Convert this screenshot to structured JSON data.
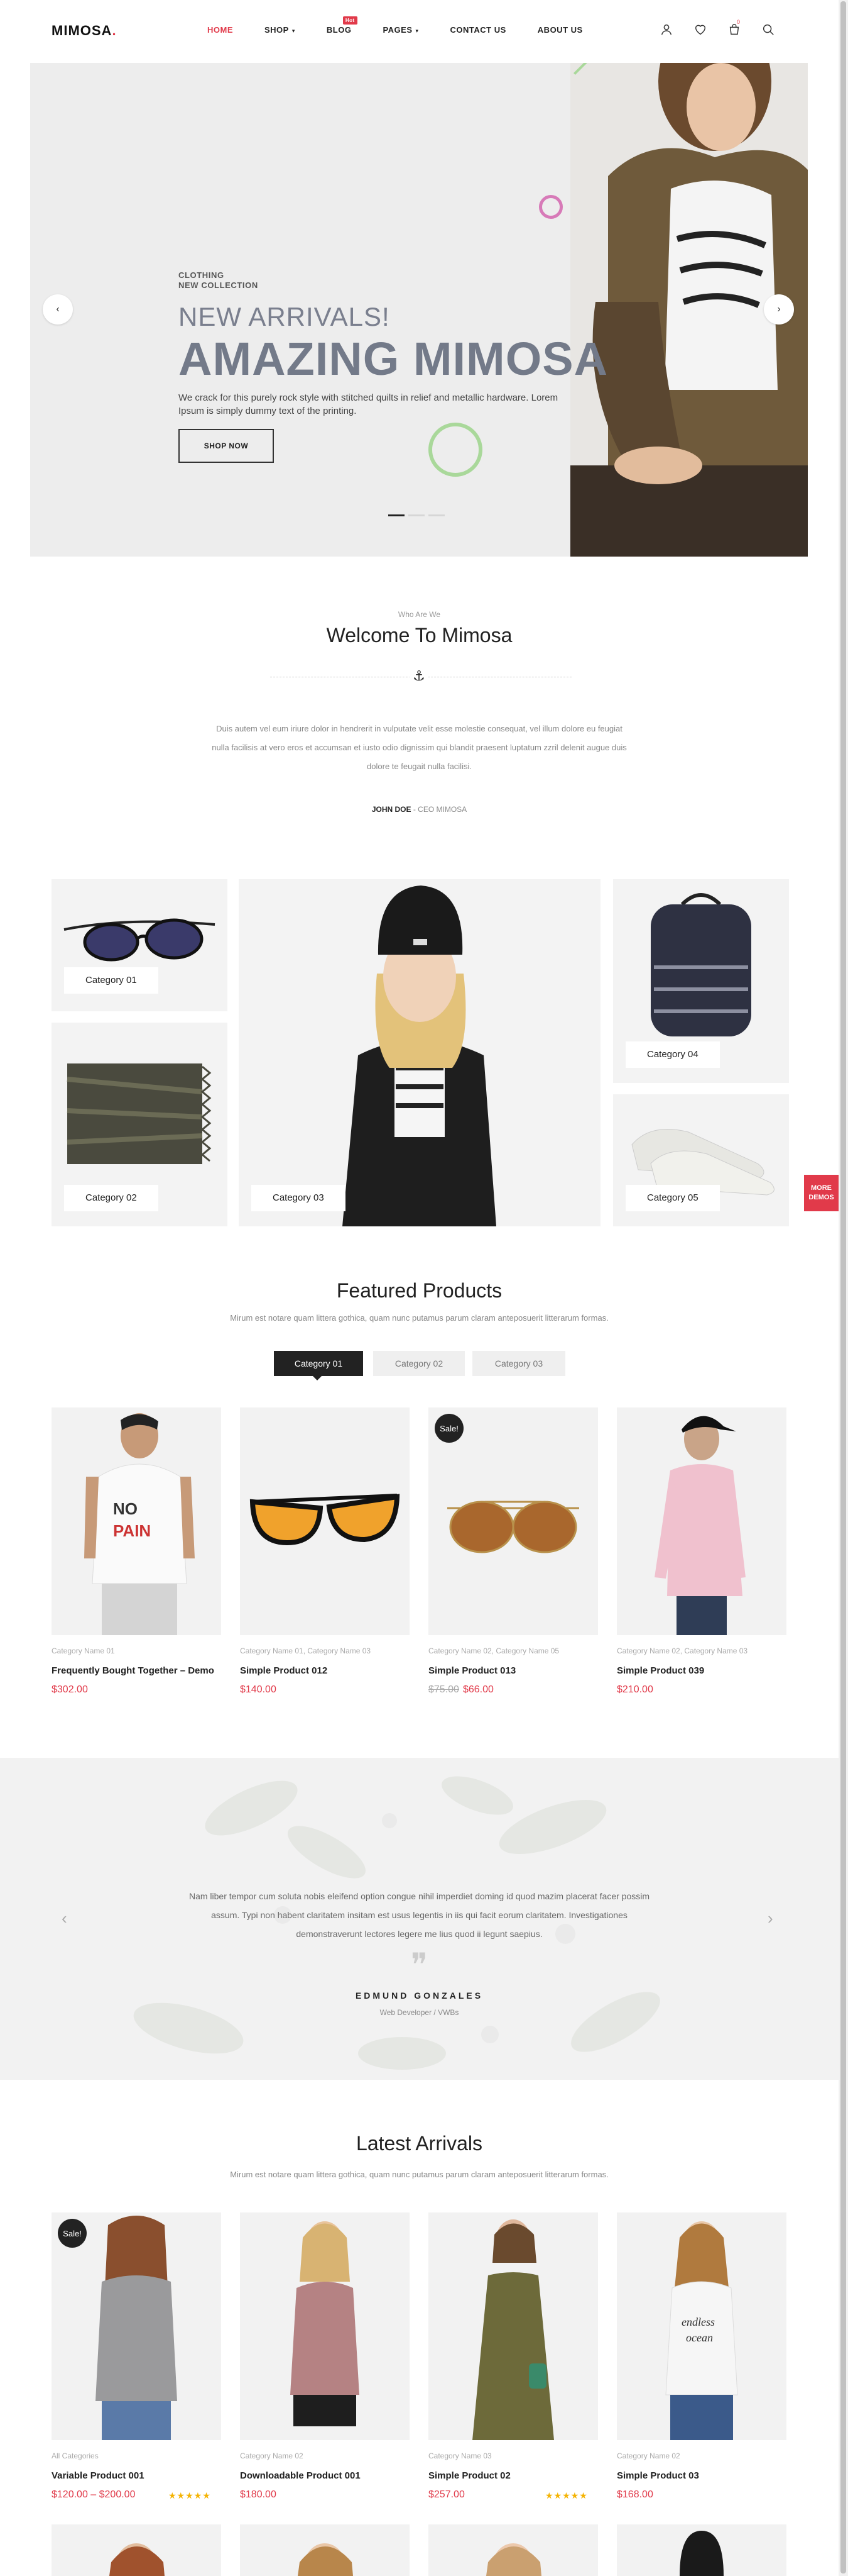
{
  "header": {
    "logo": "MIMOSA",
    "logo_dot": ".",
    "nav": [
      {
        "label": "HOME",
        "caret": ""
      },
      {
        "label": "SHOP",
        "caret": "▾"
      },
      {
        "label": "BLOG",
        "caret": "",
        "badge": "Hot"
      },
      {
        "label": "PAGES",
        "caret": "▾"
      },
      {
        "label": "CONTACT US",
        "caret": ""
      },
      {
        "label": "ABOUT US",
        "caret": ""
      }
    ],
    "cart_count": "0",
    "icons": [
      "user-icon",
      "heart-icon",
      "cart-icon",
      "search-icon"
    ]
  },
  "hero": {
    "subtitle_line1": "CLOTHING",
    "subtitle_line2": "NEW COLLECTION",
    "heading": "NEW ARRIVALS!",
    "title": "AMAZING MIMOSA",
    "description": "We crack for this purely rock style with stitched quilts in relief and metallic hardware. Lorem Ipsum is simply dummy text of the printing.",
    "button": "SHOP NOW",
    "prev": "‹",
    "next": "›"
  },
  "welcome": {
    "eyebrow": "Who Are We",
    "title": "Welcome To Mimosa",
    "text": "Duis autem vel eum iriure dolor in hendrerit in vulputate velit esse molestie consequat, vel illum dolore eu feugiat nulla facilisis at vero eros et accumsan et iusto odio dignissim qui blandit praesent luptatum zzril delenit augue duis dolore te feugait nulla facilisi.",
    "ceo_name": "JOHN DOE",
    "ceo_role": " - CEO MIMOSA"
  },
  "categories": [
    "Category 01",
    "Category 02",
    "Category 03",
    "Category 04",
    "Category 05"
  ],
  "more_demos": "MORE DEMOS",
  "featured": {
    "title": "Featured Products",
    "subtitle": "Mirum est notare quam littera gothica, quam nunc putamus parum claram anteposuerit litterarum formas.",
    "tabs": [
      "Category 01",
      "Category 02",
      "Category 03"
    ],
    "products": [
      {
        "cats": "Category Name 01",
        "name": "Frequently Bought Together – Demo",
        "price": "$302.00",
        "old_price": "",
        "sale": ""
      },
      {
        "cats": "Category Name 01, Category Name 03",
        "name": "Simple Product 012",
        "price": "$140.00",
        "old_price": "",
        "sale": ""
      },
      {
        "cats": "Category Name 02, Category Name 05",
        "name": "Simple Product 013",
        "price": "$66.00",
        "old_price": "$75.00",
        "sale": "Sale!"
      },
      {
        "cats": "Category Name 02, Category Name 03",
        "name": "Simple Product 039",
        "price": "$210.00",
        "old_price": "",
        "sale": ""
      }
    ]
  },
  "testimonial": {
    "text": "Nam liber tempor cum soluta nobis eleifend option congue nihil imperdiet doming id quod mazim placerat facer possim assum. Typi non habent claritatem insitam est usus legentis in iis qui facit eorum claritatem. Investigationes demonstraverunt lectores legere me lius quod ii legunt saepius.",
    "quote": "❞",
    "name": "EDMUND GONZALES",
    "role": "Web Developer / VWBs",
    "prev": "‹",
    "next": "›"
  },
  "latest": {
    "title": "Latest Arrivals",
    "subtitle": "Mirum est notare quam littera gothica, quam nunc putamus parum claram anteposuerit litterarum formas.",
    "products": [
      {
        "cats": "All Categories",
        "name": "Variable Product 001",
        "price": "$120.00 – $200.00",
        "sale": "Sale!",
        "stars": "★★★★★"
      },
      {
        "cats": "Category Name 02",
        "name": "Downloadable Product 001",
        "price": "$180.00",
        "sale": "",
        "stars": ""
      },
      {
        "cats": "Category Name 03",
        "name": "Simple Product 02",
        "price": "$257.00",
        "sale": "",
        "stars": "★★★★★"
      },
      {
        "cats": "Category Name 02",
        "name": "Simple Product 03",
        "price": "$168.00",
        "sale": "",
        "stars": ""
      }
    ]
  },
  "colors": {
    "accent": "#e13a4a",
    "dark": "#222222",
    "muted": "#888888"
  }
}
